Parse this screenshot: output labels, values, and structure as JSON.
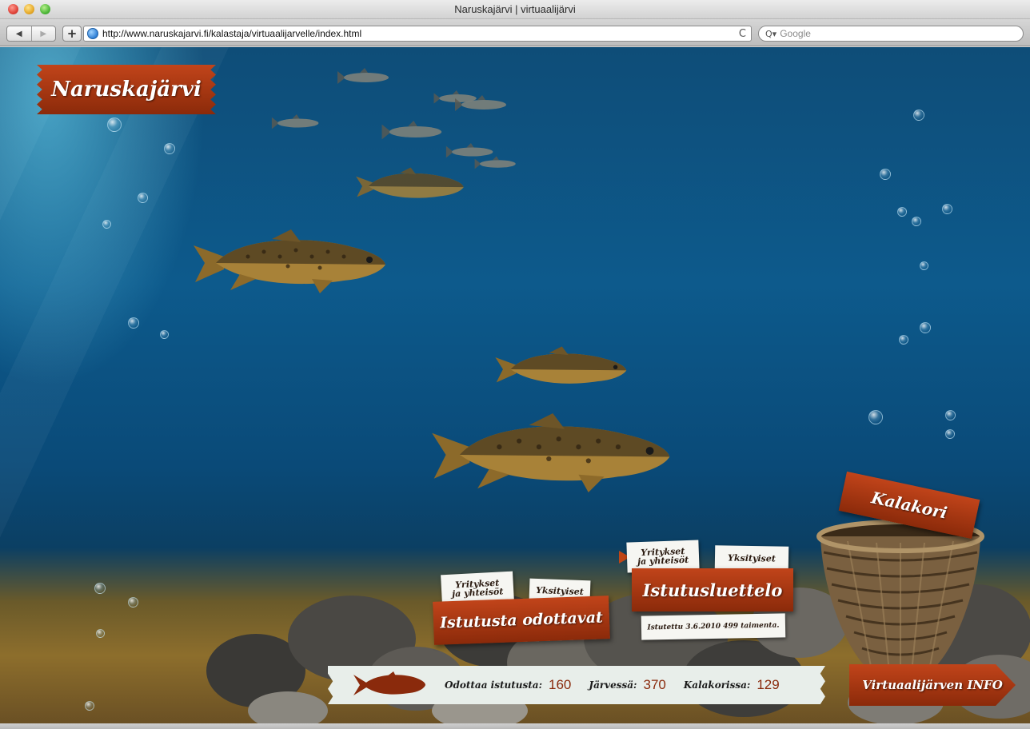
{
  "window": {
    "title": "Naruskajärvi | virtuaalijärvi"
  },
  "toolbar": {
    "back": "◀",
    "forward": "▶",
    "add": "+",
    "url": "http://www.naruskajarvi.fi/kalastaja/virtuaalijarvelle/index.html",
    "reload": "C",
    "search_icon": "Q▾",
    "search_placeholder": "Google"
  },
  "site": {
    "logo": "Naruskajärvi"
  },
  "pending": {
    "title": "Istutusta odottavat",
    "tab_companies": [
      "Yritykset",
      "ja yhteisöt"
    ],
    "tab_private": "Yksityiset"
  },
  "stocking": {
    "title": "Istutusluettelo",
    "tab_companies": [
      "Yritykset",
      "ja yhteisöt"
    ],
    "tab_private": "Yksityiset",
    "note": "Istutettu 3.6.2010 499 taimenta."
  },
  "basket": {
    "title": "Kalakori"
  },
  "stats": {
    "waiting_label": "Odottaa istutusta:",
    "waiting_value": "160",
    "lake_label": "Järvessä:",
    "lake_value": "370",
    "basket_label": "Kalakorissa:",
    "basket_value": "129"
  },
  "info": {
    "label": "Virtuaalijärven INFO"
  },
  "colors": {
    "ribbon": "#a8360f",
    "water": "#0d5a8c",
    "stat_value": "#8a2a0c"
  }
}
